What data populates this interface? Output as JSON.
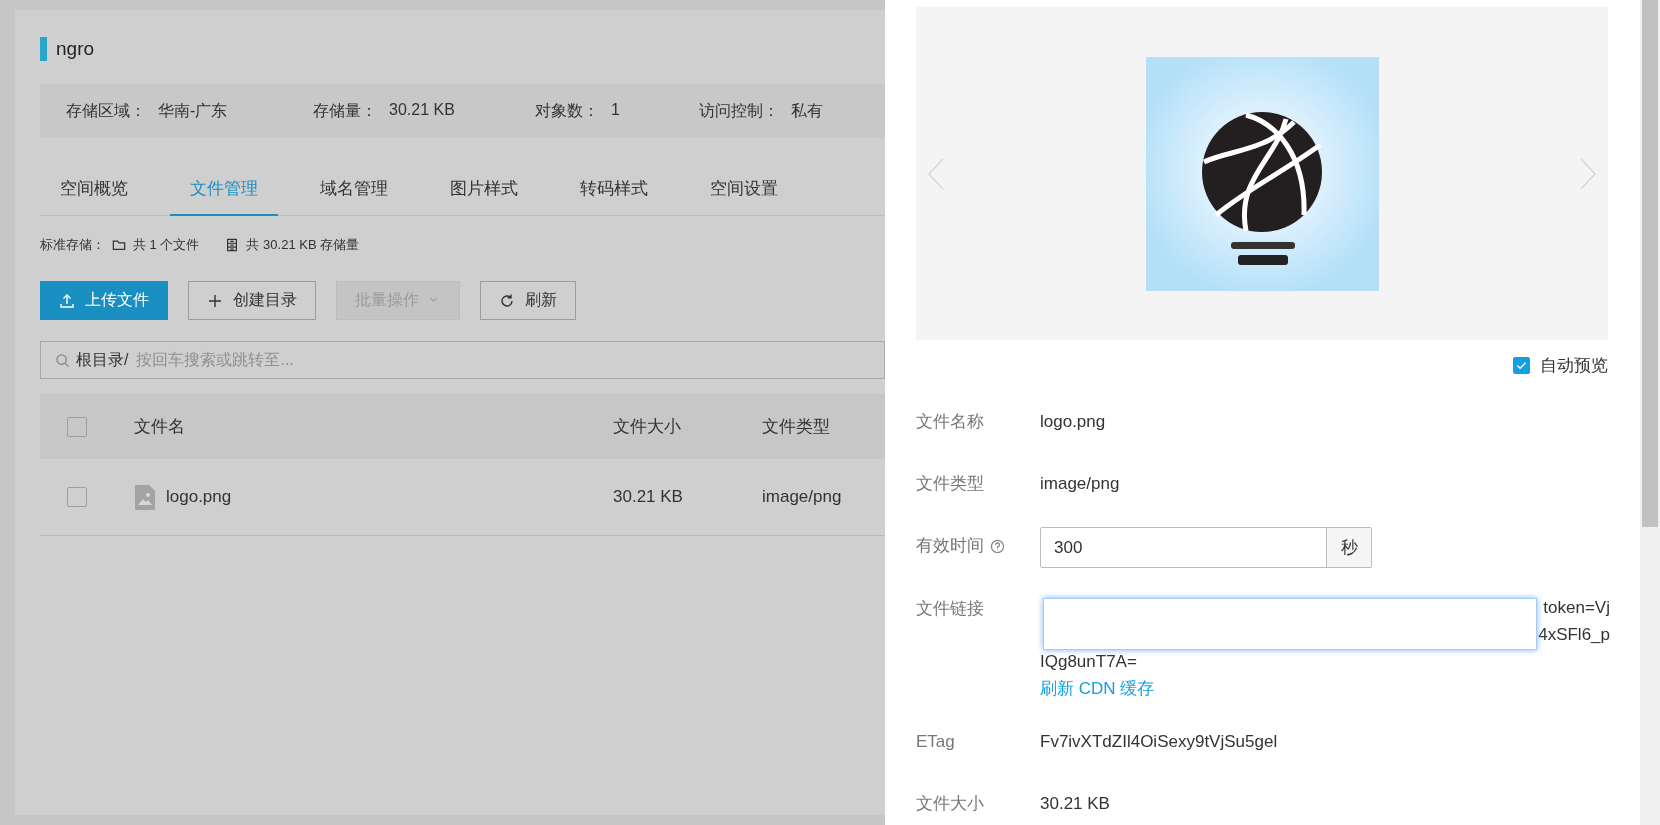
{
  "bucket": {
    "name": "ngro"
  },
  "info": [
    {
      "label": "存储区域：",
      "value": "华南-广东"
    },
    {
      "label": "存储量：",
      "value": "30.21 KB"
    },
    {
      "label": "对象数：",
      "value": "1"
    },
    {
      "label": "访问控制：",
      "value": "私有"
    }
  ],
  "tabs": [
    {
      "label": "空间概览",
      "selected": false
    },
    {
      "label": "文件管理",
      "selected": true
    },
    {
      "label": "域名管理",
      "selected": false
    },
    {
      "label": "图片样式",
      "selected": false
    },
    {
      "label": "转码样式",
      "selected": false
    },
    {
      "label": "空间设置",
      "selected": false
    }
  ],
  "summary": {
    "label": "标准存储：",
    "files": "共 1 个文件",
    "size": "共 30.21 KB 存储量"
  },
  "toolbar": [
    {
      "kind": "upload",
      "label": "上传文件",
      "disabled": false
    },
    {
      "kind": "create",
      "label": "创建目录",
      "disabled": false
    },
    {
      "kind": "dropdown",
      "label": "批量操作",
      "disabled": true
    },
    {
      "kind": "refresh",
      "label": "刷新",
      "disabled": false
    }
  ],
  "search": {
    "prefix": "根目录/",
    "placeholder": "按回车搜索或跳转至..."
  },
  "table": {
    "header_checked": false,
    "columns": [
      "文件名",
      "文件大小",
      "文件类型"
    ],
    "rows": [
      {
        "checked": false,
        "name": "logo.png",
        "size": "30.21 KB",
        "type": "image/png"
      }
    ]
  },
  "drawer": {
    "auto_preview": {
      "label": "自动预览",
      "checked": true
    },
    "fields": [
      {
        "kind": "text",
        "label": "文件名称",
        "value": "logo.png"
      },
      {
        "kind": "text",
        "label": "文件类型",
        "value": "image/png"
      },
      {
        "kind": "input",
        "label": "有效时间",
        "help": true,
        "value": "300",
        "unit": "秒"
      },
      {
        "kind": "link",
        "label": "文件链接",
        "lines": [
          "token=Vj",
          "4xSFl6_p",
          "IQg8unT7A="
        ],
        "action": "刷新 CDN 缓存"
      },
      {
        "kind": "text",
        "label": "ETag",
        "value": "Fv7ivXTdZIl4OiSexy9tVjSu5gel"
      },
      {
        "kind": "text",
        "label": "文件大小",
        "value": "30.21 KB"
      }
    ]
  }
}
